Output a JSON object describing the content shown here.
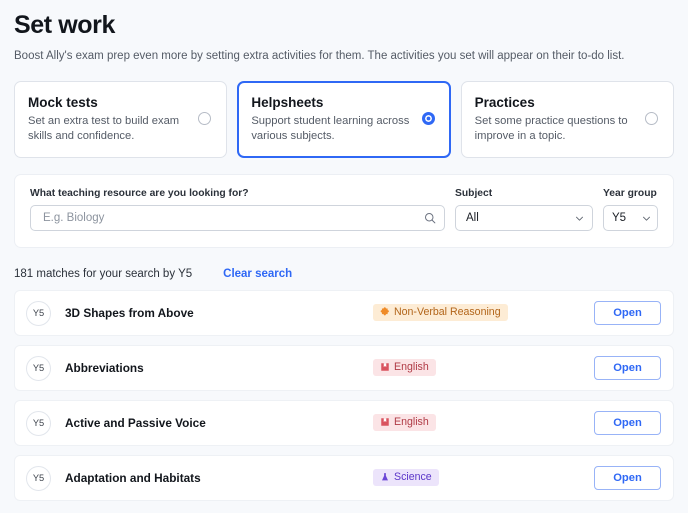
{
  "header": {
    "title": "Set work",
    "subtitle": "Boost Ally's exam prep even more by setting extra activities for them. The activities you set will appear on their to-do list."
  },
  "work_types": [
    {
      "name": "Mock tests",
      "description": "Set an extra test to build exam skills and confidence.",
      "selected": false
    },
    {
      "name": "Helpsheets",
      "description": "Support student learning across various subjects.",
      "selected": true
    },
    {
      "name": "Practices",
      "description": "Set some practice questions to improve in a topic.",
      "selected": false
    }
  ],
  "filters": {
    "search": {
      "label": "What teaching resource are you looking for?",
      "value": "",
      "placeholder": "E.g. Biology",
      "icon": "search-icon"
    },
    "subject": {
      "label": "Subject",
      "value": "All",
      "icon": "chevron-down-icon"
    },
    "year_group": {
      "label": "Year group",
      "value": "Y5",
      "icon": "chevron-down-icon"
    }
  },
  "results": {
    "count_text": "181 matches for your search by Y5",
    "clear_label": "Clear search",
    "open_label": "Open",
    "rows": [
      {
        "year": "Y5",
        "title": "3D Shapes from Above",
        "subject": "Non-Verbal Reasoning",
        "subject_key": "nvr",
        "subject_icon": "puzzle-piece-icon",
        "subject_color": "#b2651a",
        "subject_bg": "#fdecd5"
      },
      {
        "year": "Y5",
        "title": "Abbreviations",
        "subject": "English",
        "subject_key": "english",
        "subject_icon": "book-icon",
        "subject_color": "#b03b46",
        "subject_bg": "#fbe4e6"
      },
      {
        "year": "Y5",
        "title": "Active and Passive Voice",
        "subject": "English",
        "subject_key": "english",
        "subject_icon": "book-icon",
        "subject_color": "#b03b46",
        "subject_bg": "#fbe4e6"
      },
      {
        "year": "Y5",
        "title": "Adaptation and Habitats",
        "subject": "Science",
        "subject_key": "science",
        "subject_icon": "flask-icon",
        "subject_color": "#5b36c9",
        "subject_bg": "#ece4fb"
      }
    ]
  },
  "colors": {
    "accent": "#2f68f5",
    "page_bg": "#f7f9fc",
    "card_bg": "#ffffff"
  }
}
